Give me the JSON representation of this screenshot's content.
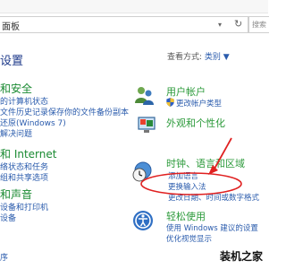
{
  "address": {
    "path": "面板",
    "dropdown_icon": "chevron-down-icon",
    "refresh_icon": "refresh-icon"
  },
  "search": {
    "placeholder": "搜索"
  },
  "heading": "设置",
  "view_by": {
    "label": "查看方式:",
    "value": "类别 ▼"
  },
  "left": {
    "sections": [
      {
        "title": "和安全",
        "items": [
          "的计算机状态",
          "文件历史记录保存你的文件备份副本",
          "还原(Windows 7)",
          "解决问题"
        ]
      },
      {
        "title": "和 Internet",
        "items": [
          "络状态和任务",
          "组和共享选项"
        ]
      },
      {
        "title": "和声音",
        "items": [
          "设备和打印机",
          "设备"
        ]
      },
      {
        "title": "",
        "items": [
          "序"
        ]
      }
    ]
  },
  "right": {
    "categories": [
      {
        "title": "用户帐户",
        "items": [
          "更改帐户类型"
        ]
      },
      {
        "title": "外观和个性化",
        "items": []
      },
      {
        "title": "时钟、语言和区域",
        "items": [
          "添加语言",
          "更换输入法",
          "更改日期、时间或数字格式"
        ]
      },
      {
        "title": "轻松使用",
        "items": [
          "使用 Windows 建议的设置",
          "优化视觉显示"
        ]
      }
    ]
  },
  "annotation": {
    "color": "#e02020"
  },
  "watermark": "装机之家"
}
